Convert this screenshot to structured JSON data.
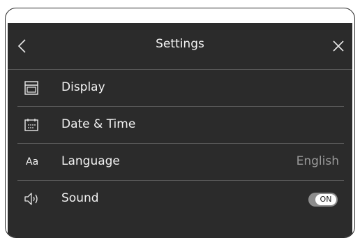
{
  "header": {
    "title": "Settings",
    "back_icon": "chevron-left-icon",
    "close_icon": "close-icon"
  },
  "items": [
    {
      "id": "display",
      "icon": "oven-display-icon",
      "label": "Display"
    },
    {
      "id": "date-time",
      "icon": "calendar-icon",
      "label": "Date & Time"
    },
    {
      "id": "language",
      "icon": "aa-text-icon",
      "icon_text": "Aa",
      "label": "Language",
      "value": "English"
    },
    {
      "id": "sound",
      "icon": "speaker-icon",
      "label": "Sound",
      "toggle": {
        "state": "ON"
      }
    }
  ],
  "colors": {
    "screen_bg": "#2b2b2b",
    "text": "#f2f2f2",
    "value_text": "#9a9a9a",
    "divider": "#5a5a5a",
    "toggle_track": "#8d8d8d"
  }
}
